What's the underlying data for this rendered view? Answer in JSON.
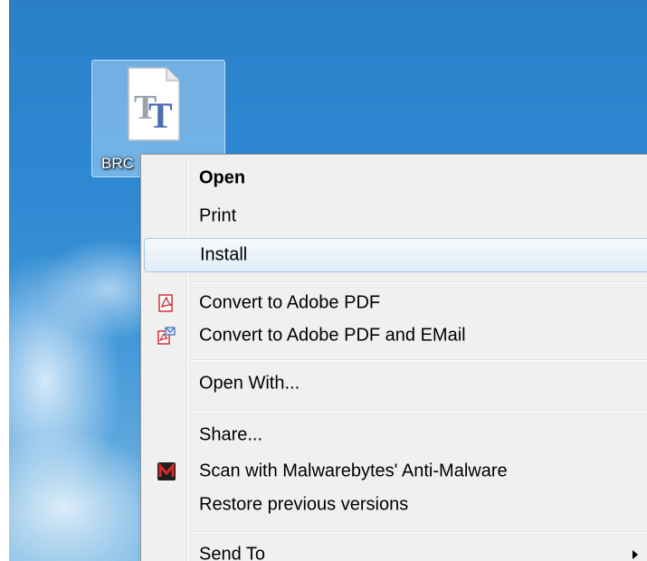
{
  "desktop_icon": {
    "label": "BRC",
    "icon": "truetype-font-file-icon"
  },
  "menu": {
    "items": [
      {
        "label": "Open",
        "bold": true
      },
      {
        "label": "Print"
      },
      {
        "label": "Install",
        "highlighted": true
      },
      {
        "label": "Convert to Adobe PDF",
        "icon": "adobe-pdf-icon"
      },
      {
        "label": "Convert to Adobe PDF and EMail",
        "icon": "adobe-pdf-email-icon"
      },
      {
        "label": "Open With..."
      },
      {
        "label": "Share..."
      },
      {
        "label": "Scan with Malwarebytes' Anti-Malware",
        "icon": "malwarebytes-icon"
      },
      {
        "label": "Restore previous versions"
      },
      {
        "label": "Send To",
        "submenu": true
      }
    ]
  },
  "colors": {
    "highlight_border": "#a8c8e8",
    "menu_background": "#f0f0f0",
    "desktop_blue": "#2f8ad3"
  }
}
